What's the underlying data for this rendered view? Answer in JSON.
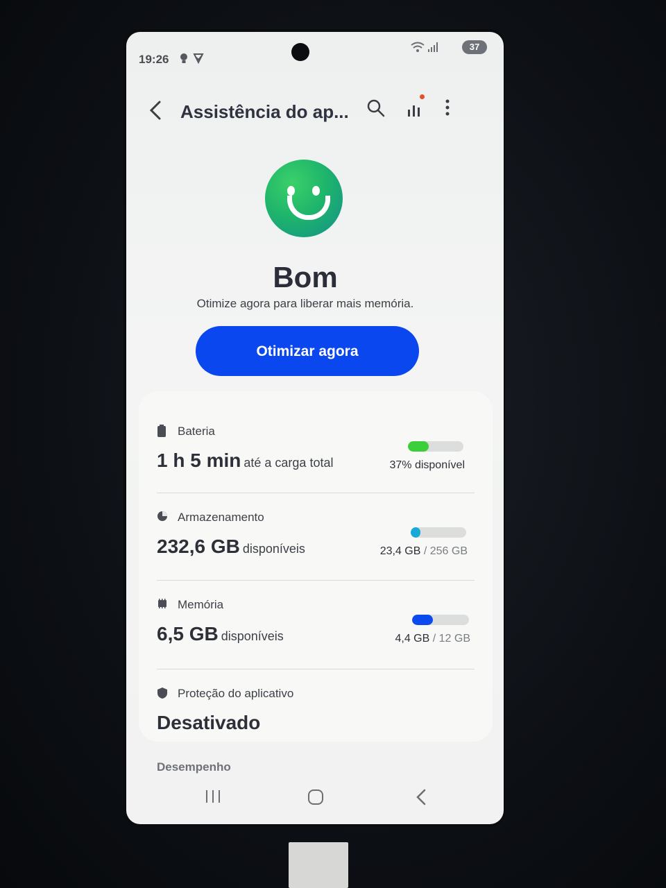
{
  "status_bar": {
    "time": "19:26",
    "battery_level": "37"
  },
  "app_bar": {
    "title": "Assistência do ap..."
  },
  "hero": {
    "status_word": "Bom",
    "subtitle": "Otimize agora para liberar mais memória.",
    "optimize_label": "Otimizar agora"
  },
  "battery": {
    "label": "Bateria",
    "value": "1 h 5 min",
    "value_suffix": "até a carga total",
    "right_text": "37% disponível",
    "percent_available": 37,
    "color": "#3ccf3a"
  },
  "storage": {
    "label": "Armazenamento",
    "value": "232,6 GB",
    "value_suffix": "disponíveis",
    "used": "23,4 GB",
    "total": "/ 256 GB",
    "used_fraction": 0.091,
    "color": "#19a9d9"
  },
  "memory": {
    "label": "Memória",
    "value": "6,5 GB",
    "value_suffix": "disponíveis",
    "used": "4,4 GB",
    "total": "/ 12 GB",
    "used_fraction": 0.367,
    "color": "#0b4bee"
  },
  "app_protection": {
    "label": "Proteção do aplicativo",
    "value": "Desativado"
  },
  "section": {
    "performance": "Desempenho"
  },
  "colors": {
    "primary_button": "#0a47ee",
    "accent_red_dot": "#e3502a"
  }
}
